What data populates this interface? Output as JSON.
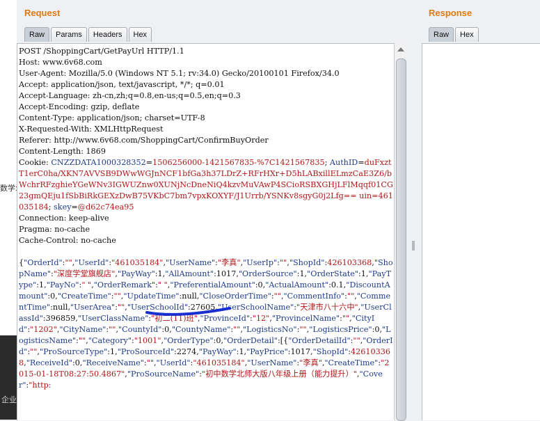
{
  "background": {
    "fragment_left": "数学:",
    "fragment_bottom": "企业务"
  },
  "request": {
    "title": "Request",
    "tabs": [
      "Raw",
      "Params",
      "Headers",
      "Hex"
    ],
    "active_tab": "Raw",
    "lines": [
      "POST /ShoppingCart/GetPayUrl HTTP/1.1",
      "Host: www.6v68.com",
      "User-Agent: Mozilla/5.0 (Windows NT 5.1; rv:34.0) Gecko/20100101 Firefox/34.0",
      "Accept: application/json, text/javascript, */*; q=0.01",
      "Accept-Language: zh-cn,zh;q=0.8,en-us;q=0.5,en;q=0.3",
      "Accept-Encoding: gzip, deflate",
      "Content-Type: application/json; charset=UTF-8",
      "X-Requested-With: XMLHttpRequest",
      "Referer: http://www.6v68.com/ShoppingCart/ConfirmBuyOrder",
      "Content-Length: 1869"
    ],
    "cookie_label": "Cookie: ",
    "cookies": [
      {
        "name": "CNZZDATA1000328352",
        "value": "1506256000-1421567835-%7C1421567835",
        "sep": "; "
      },
      {
        "name": "AuthID",
        "value": "duFxztT1erC0ha/XKN7AVVSB9DWwWGJnNCF1bfGa3h37LDrZ+RFrHXr+D5hLABxillELmzCaE3Z6/bWchrRFzghieYGeWNv3IGWUZnw0XUNjNcDneNiQ4kzvMuVAwP4SCioRSBXGHjLFlMqqf01CG23gmQEju1fSbBiRkGEXzDwB75VKbC7bm7vpxKOXYF/J1Urrb/YSNKv8sgyG0j2Lfg== uin=461035184",
        "sep": "; "
      },
      {
        "name": "skey",
        "value": "@d62c74ea95",
        "sep": ""
      }
    ],
    "lines_after": [
      "Connection: keep-alive",
      "Pragma: no-cache",
      "Cache-Control: no-cache"
    ],
    "body_tokens": [
      [
        "p",
        "{"
      ],
      [
        "k",
        "\"OrderId\""
      ],
      [
        "p",
        ":"
      ],
      [
        "s",
        "\"\""
      ],
      [
        "p",
        ","
      ],
      [
        "k",
        "\"UserId\""
      ],
      [
        "p",
        ":"
      ],
      [
        "s",
        "\"461035184\""
      ],
      [
        "p",
        ","
      ],
      [
        "k",
        "\"UserName\""
      ],
      [
        "p",
        ":"
      ],
      [
        "s",
        "\"李真\""
      ],
      [
        "p",
        ","
      ],
      [
        "k",
        "\"UserIp\""
      ],
      [
        "p",
        ":"
      ],
      [
        "s",
        "\"\""
      ],
      [
        "p",
        ","
      ],
      [
        "k",
        "\"ShopId\""
      ],
      [
        "p",
        ":"
      ],
      [
        "s",
        "426103368"
      ],
      [
        "p",
        ","
      ],
      [
        "k",
        "\"ShopName\""
      ],
      [
        "p",
        ":"
      ],
      [
        "s",
        "\"深度学堂旗舰店\""
      ],
      [
        "p",
        ","
      ],
      [
        "k",
        "\"PayWay\""
      ],
      [
        "p",
        ":1,"
      ],
      [
        "k",
        "\"AllAmount\""
      ],
      [
        "p",
        ":1017,"
      ],
      [
        "k",
        "\"OrderSource\""
      ],
      [
        "p",
        ":1,"
      ],
      [
        "k",
        "\"OrderState\""
      ],
      [
        "p",
        ":1,"
      ],
      [
        "k",
        "\"PayType\""
      ],
      [
        "p",
        ":1,"
      ],
      [
        "k",
        "\"PayNo\""
      ],
      [
        "p",
        ":"
      ],
      [
        "s",
        "\" \""
      ],
      [
        "p",
        ","
      ],
      [
        "k",
        "\"OrderRemark\""
      ],
      [
        "p",
        ":"
      ],
      [
        "s",
        "\" \""
      ],
      [
        "p",
        ","
      ],
      [
        "k",
        "\"PreferentialAmount\""
      ],
      [
        "p",
        ":0,"
      ],
      [
        "k",
        "\"ActualAmount\""
      ],
      [
        "p",
        ":0.1"
      ],
      [
        "p",
        ","
      ],
      [
        "k",
        "\"DiscountAmount\""
      ],
      [
        "p",
        ":0,"
      ],
      [
        "k",
        "\"CreateTime\""
      ],
      [
        "p",
        ":"
      ],
      [
        "s",
        "\"\""
      ],
      [
        "p",
        ","
      ],
      [
        "k",
        "\"UpdateTime\""
      ],
      [
        "p",
        ":null,"
      ],
      [
        "k",
        "\"CloseOrderTime\""
      ],
      [
        "p",
        ":"
      ],
      [
        "s",
        "\"\""
      ],
      [
        "p",
        ","
      ],
      [
        "k",
        "\"CommentInfo\""
      ],
      [
        "p",
        ":"
      ],
      [
        "s",
        "\"\""
      ],
      [
        "p",
        ","
      ],
      [
        "k",
        "\"CommentTime\""
      ],
      [
        "p",
        ":null,"
      ],
      [
        "k",
        "\"UserArea\""
      ],
      [
        "p",
        ":"
      ],
      [
        "s",
        "\"\""
      ],
      [
        "p",
        ","
      ],
      [
        "k",
        "\"UserSchoolId\""
      ],
      [
        "p",
        ":27605,"
      ],
      [
        "k",
        "\"UserSchoolName\""
      ],
      [
        "p",
        ":"
      ],
      [
        "s",
        "\"天津市八十六中\""
      ],
      [
        "p",
        ","
      ],
      [
        "k",
        "\"UserClassId\""
      ],
      [
        "p",
        ":396859,"
      ],
      [
        "k",
        "\"UserClassName\""
      ],
      [
        "p",
        ":"
      ],
      [
        "s",
        "\"初二(11)班\""
      ],
      [
        "p",
        ","
      ],
      [
        "k",
        "\"ProvinceId\""
      ],
      [
        "p",
        ":"
      ],
      [
        "s",
        "\"12\""
      ],
      [
        "p",
        ","
      ],
      [
        "k",
        "\"ProvincelName\""
      ],
      [
        "p",
        ":"
      ],
      [
        "s",
        "\"\""
      ],
      [
        "p",
        ","
      ],
      [
        "k",
        "\"CityId\""
      ],
      [
        "p",
        ":"
      ],
      [
        "s",
        "\"1202\""
      ],
      [
        "p",
        ","
      ],
      [
        "k",
        "\"CityName\""
      ],
      [
        "p",
        ":"
      ],
      [
        "s",
        "\"\""
      ],
      [
        "p",
        ","
      ],
      [
        "k",
        "\"CountyId\""
      ],
      [
        "p",
        ":0,"
      ],
      [
        "k",
        "\"CountyName\""
      ],
      [
        "p",
        ":"
      ],
      [
        "s",
        "\"\""
      ],
      [
        "p",
        ","
      ],
      [
        "k",
        "\"LogisticsNo\""
      ],
      [
        "p",
        ":"
      ],
      [
        "s",
        "\"\""
      ],
      [
        "p",
        ","
      ],
      [
        "k",
        "\"LogisticsPrice\""
      ],
      [
        "p",
        ":0,"
      ],
      [
        "k",
        "\"LogisticsName\""
      ],
      [
        "p",
        ":"
      ],
      [
        "s",
        "\"\""
      ],
      [
        "p",
        ","
      ],
      [
        "k",
        "\"Category\""
      ],
      [
        "p",
        ":"
      ],
      [
        "s",
        "\"1001\""
      ],
      [
        "p",
        ","
      ],
      [
        "k",
        "\"OrderType\""
      ],
      [
        "p",
        ":0,"
      ],
      [
        "k",
        "\"OrderDetail\""
      ],
      [
        "p",
        ":[{"
      ],
      [
        "k",
        "\"OrderDetailId\""
      ],
      [
        "p",
        ":"
      ],
      [
        "s",
        "\"\""
      ],
      [
        "p",
        ","
      ],
      [
        "k",
        "\"OrderId\""
      ],
      [
        "p",
        ":"
      ],
      [
        "s",
        "\"\""
      ],
      [
        "p",
        ","
      ],
      [
        "k",
        "\"ProSourceType\""
      ],
      [
        "p",
        ":1,"
      ],
      [
        "k",
        "\"ProSourceId\""
      ],
      [
        "p",
        ":2274,"
      ],
      [
        "k",
        "\"PayWay\""
      ],
      [
        "p",
        ":1,"
      ],
      [
        "k",
        "\"PayPrice\""
      ],
      [
        "p",
        ":1017,"
      ],
      [
        "k",
        "\"ShopId\""
      ],
      [
        "p",
        ":"
      ],
      [
        "s",
        "426103368"
      ],
      [
        "p",
        ","
      ],
      [
        "k",
        "\"ReceiveId\""
      ],
      [
        "p",
        ":0,"
      ],
      [
        "k",
        "\"ReceiveName\""
      ],
      [
        "p",
        ":"
      ],
      [
        "s",
        "\"\""
      ],
      [
        "p",
        ","
      ],
      [
        "k",
        "\"UserId\""
      ],
      [
        "p",
        ":"
      ],
      [
        "s",
        "\"461035184\""
      ],
      [
        "p",
        ","
      ],
      [
        "k",
        "\"UserName\""
      ],
      [
        "p",
        ":"
      ],
      [
        "s",
        "\"李真\""
      ],
      [
        "p",
        ","
      ],
      [
        "k",
        "\"CreateTime\""
      ],
      [
        "p",
        ":"
      ],
      [
        "s",
        "\"2015-01-18T08:27:50.4867\""
      ],
      [
        "p",
        ","
      ],
      [
        "k",
        "\"ProSourceName\""
      ],
      [
        "p",
        ":"
      ],
      [
        "s",
        "\"初中数学北师大版八年级上册（能力提升）\""
      ],
      [
        "p",
        ","
      ],
      [
        "k",
        "\"Cover\""
      ],
      [
        "p",
        ":"
      ],
      [
        "s",
        "\"http:"
      ]
    ]
  },
  "response": {
    "title": "Response",
    "tabs": [
      "Raw",
      "Hex"
    ],
    "active_tab": "Raw"
  },
  "colors": {
    "title": "#e07a10",
    "key": "#1f3b8c",
    "string": "#b01818",
    "annotation": "#1a2fd0"
  }
}
